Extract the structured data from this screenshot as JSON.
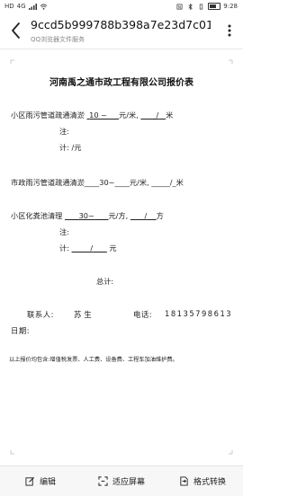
{
  "status_bar": {
    "carrier": "HD",
    "network": "4G",
    "battery": "81",
    "time": "9:28"
  },
  "header": {
    "title": "9ccd5b999788b398a7e23d7c01...",
    "subtitle": "QQ浏览器文件服务"
  },
  "document": {
    "title": "河南禹之通市政工程有限公司报价表",
    "lines": [
      {
        "a": "小区雨污管道疏通清淤",
        "b": "10 ~",
        "c": "元/米,",
        "d": "_/",
        "e": "米"
      },
      {
        "label": "注:"
      },
      {
        "label": "计: /元"
      },
      {
        "text": "市政雨污管道疏通清淤____30~____元/米, _____/_米"
      },
      {
        "a": "小区化粪池清理",
        "b": "30~",
        "c": "元/方,",
        "d": "/",
        "e": "方"
      },
      {
        "label": "注:"
      },
      {
        "label": "计:",
        "mid": "/",
        "end": "元"
      },
      {
        "label": "总计:"
      }
    ],
    "contact": {
      "person_label": "联系人:",
      "person_name": "苏生",
      "phone_label": "电话:",
      "phone": "18135798613",
      "date_label": "日期:"
    },
    "footnote": "以上报价均包含:增值税发票、人工费、设备费、工程车加油维护费。"
  },
  "toolbar": {
    "edit": "编辑",
    "fit": "适应屏幕",
    "convert": "格式转换"
  }
}
